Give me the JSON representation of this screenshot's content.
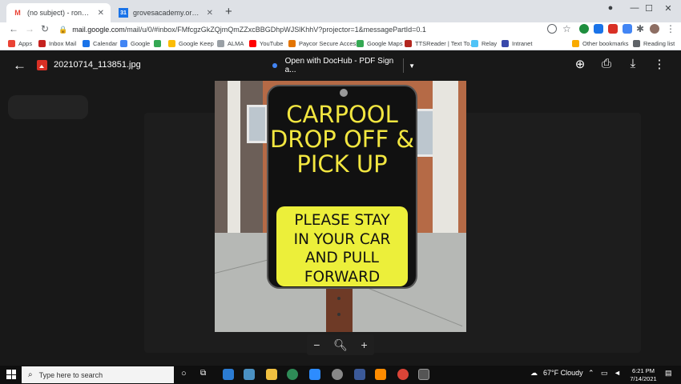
{
  "browser": {
    "tabs": [
      {
        "label": "(no subject) - roneyc@grovesacad",
        "icon": "gmail-icon"
      },
      {
        "label": "grovesacademy.org - Calendar - W",
        "icon": "calendar-icon"
      }
    ],
    "new_tab": "+",
    "window_controls": {
      "minimize": "—",
      "maximize": "☐",
      "close": "✕"
    },
    "nav": {
      "back": "←",
      "forward": "→",
      "reload": "↻"
    },
    "url_host": "mail.google.com",
    "url_path": "/mail/u/0/#inbox/FMfcgzGkZQjmQmZZxcBBGDhpWJSlKhhV?projector=1&messagePartId=0.1"
  },
  "bookmarks": [
    {
      "label": "Apps",
      "color": "#ea4335"
    },
    {
      "label": "Inbox Mail",
      "color": "#c5221f"
    },
    {
      "label": "Calendar",
      "color": "#1a73e8"
    },
    {
      "label": "Google",
      "color": "#4285f4"
    },
    {
      "label": "",
      "color": "#34a853"
    },
    {
      "label": "Google Keep",
      "color": "#fbbc04"
    },
    {
      "label": "ALMA",
      "color": "#9aa0a6"
    },
    {
      "label": "YouTube",
      "color": "#ff0000"
    },
    {
      "label": "Paycor Secure Access",
      "color": "#e37400"
    },
    {
      "label": "Google Maps",
      "color": "#34a853"
    },
    {
      "label": "TTSReader | Text To...",
      "color": "#b3261e"
    },
    {
      "label": "Relay",
      "color": "#4fc3f7"
    },
    {
      "label": "Intranet",
      "color": "#3949ab"
    },
    {
      "label": "Other bookmarks",
      "color": "#f9ab00"
    },
    {
      "label": "Reading list",
      "color": "#5f6368"
    }
  ],
  "viewer": {
    "file_name": "20210714_113851.jpg",
    "open_with": "Open with DocHub - PDF Sign a...",
    "icons": [
      "add-to-drive-icon",
      "print-icon",
      "download-icon",
      "more-icon"
    ]
  },
  "sign": {
    "top_lines": [
      "CARPOOL",
      "DROP OFF &",
      "PICK UP"
    ],
    "bottom_lines": [
      "PLEASE STAY",
      "IN YOUR CAR",
      "AND PULL",
      "FORWARD"
    ]
  },
  "zoom": {
    "out": "−",
    "icon": "zoom-icon",
    "in": "+"
  },
  "taskbar": {
    "search_placeholder": "Type here to search",
    "weather": "67°F  Cloudy",
    "time": "6:21 PM",
    "date": "7/14/2021"
  }
}
